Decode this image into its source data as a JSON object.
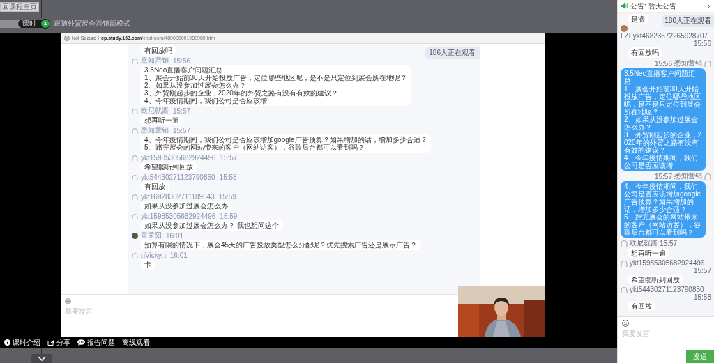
{
  "header": {
    "home_button": "回课程主页",
    "lesson_label": "课时",
    "lesson_number": "1",
    "lesson_title": "跟随外贸展会营销新模式"
  },
  "browser": {
    "security": "Not Secure",
    "url_host": "cp.study.163.com",
    "url_path": "/chatroom/480000001989989.htm",
    "viewers": "186人正在观看",
    "messages": [
      {
        "lines": [
          "有回放吗"
        ]
      },
      {
        "name": "悉知营销",
        "time": "15:56",
        "photo": false,
        "lines": [
          "3.5Neo直播客户问题汇总",
          "1、展会开始前30天开始投放广告，定位哪些地区呢，是不是只定位到展会所在地呢？",
          "2、如果从没参加过展会怎么办？",
          "3、外贸刚起步的企业，2020年的外贸之路有没有有效的建议？",
          "4、今年疫情期间，我们公司是否应该增"
        ]
      },
      {
        "name": "欧尼就酱",
        "time": "15:57",
        "photo": false,
        "lines": [
          "想再听一遍"
        ]
      },
      {
        "name": "悉知营销",
        "time": "15:57",
        "photo": false,
        "lines": [
          "4、今年疫情期间，我们公司是否应该增加google广告预算？如果增加的话，增加多少合适？",
          "5、蹭完展会的网站带来的客户（网站访客），谷歌后台都可以看到吗？"
        ]
      },
      {
        "name": "ykt15985305682924496",
        "time": "15:57",
        "photo": false,
        "lines": [
          "希望能听到回放"
        ]
      },
      {
        "name": "ykt54430271123790850",
        "time": "15:58",
        "photo": false,
        "lines": [
          "有回放"
        ]
      },
      {
        "name": "ykt16928302711189643",
        "time": "15:59",
        "photo": false,
        "lines": [
          "如果从没参加过展会怎么办"
        ]
      },
      {
        "name": "ykt15985305682924496",
        "time": "15:59",
        "photo": false,
        "lines": [
          "如果从没参加过展会怎么办？ 我也想问这个"
        ]
      },
      {
        "name": "董孟阳",
        "time": "16:01",
        "photo": true,
        "lines": [
          "预算有限的情况下，展会45天的广告投放类型怎么分配呢？优先搜索广告还是展示广告？"
        ]
      },
      {
        "name": "□Vicky□",
        "time": "16:01",
        "photo": false,
        "lines": [
          "卡"
        ]
      }
    ],
    "input_placeholder": "我要发言"
  },
  "bottom_links": [
    {
      "kind": "info",
      "label": "课时介绍"
    },
    {
      "kind": "share",
      "label": "分享"
    },
    {
      "kind": "chat",
      "label": "报告问题"
    },
    {
      "kind": "plain",
      "label": "离线观看"
    }
  ],
  "sidebar": {
    "notice": "公告: 暂无公告",
    "viewers": "180人正在观看",
    "messages": [
      {
        "kind": "incoming",
        "lines": [
          "是滴"
        ]
      },
      {
        "kind": "incoming",
        "name": "LZFykt46823672265928707",
        "time": "15:56",
        "photo": true,
        "lines": [
          "有回放吗"
        ]
      },
      {
        "kind": "outgoing",
        "name": "悉知营销",
        "time": "15:56",
        "photo": false,
        "lines": [
          "3.5Neo直播客户问题汇总",
          "1、展会开始前30天开始投放广告，定位哪些地区呢，是不是只定位到展会所在地呢？",
          "2、如果从没参加过展会怎么办？",
          "3、外贸刚起步的企业，2020年的外贸之路有没有有效的建议？",
          "4、今年疫情期间，我们公司是否应该增"
        ]
      },
      {
        "kind": "outgoing",
        "name": "悉知营销",
        "time": "15:57",
        "photo": false,
        "lines": [
          "4、今年疫情期间，我们公司是否应该增加google广告预算？如果增加的话，增加多少合适？",
          "5、蹭完展会的网站带来的客户（网站访客），谷歌后台都可以看到吗？"
        ]
      },
      {
        "kind": "incoming",
        "name": "欧尼就酱",
        "time": "15:57",
        "photo": false,
        "lines": [
          "想再听一遍"
        ]
      },
      {
        "kind": "incoming",
        "name": "ykt15985305682924496",
        "time": "15:57",
        "photo": false,
        "lines": [
          "希望能听到回放"
        ]
      },
      {
        "kind": "incoming",
        "name": "ykt54430271123790850",
        "time": "15:58",
        "photo": false,
        "lines": [
          "有回放"
        ]
      }
    ],
    "input_placeholder": "我要发言",
    "send_button": "发送"
  }
}
